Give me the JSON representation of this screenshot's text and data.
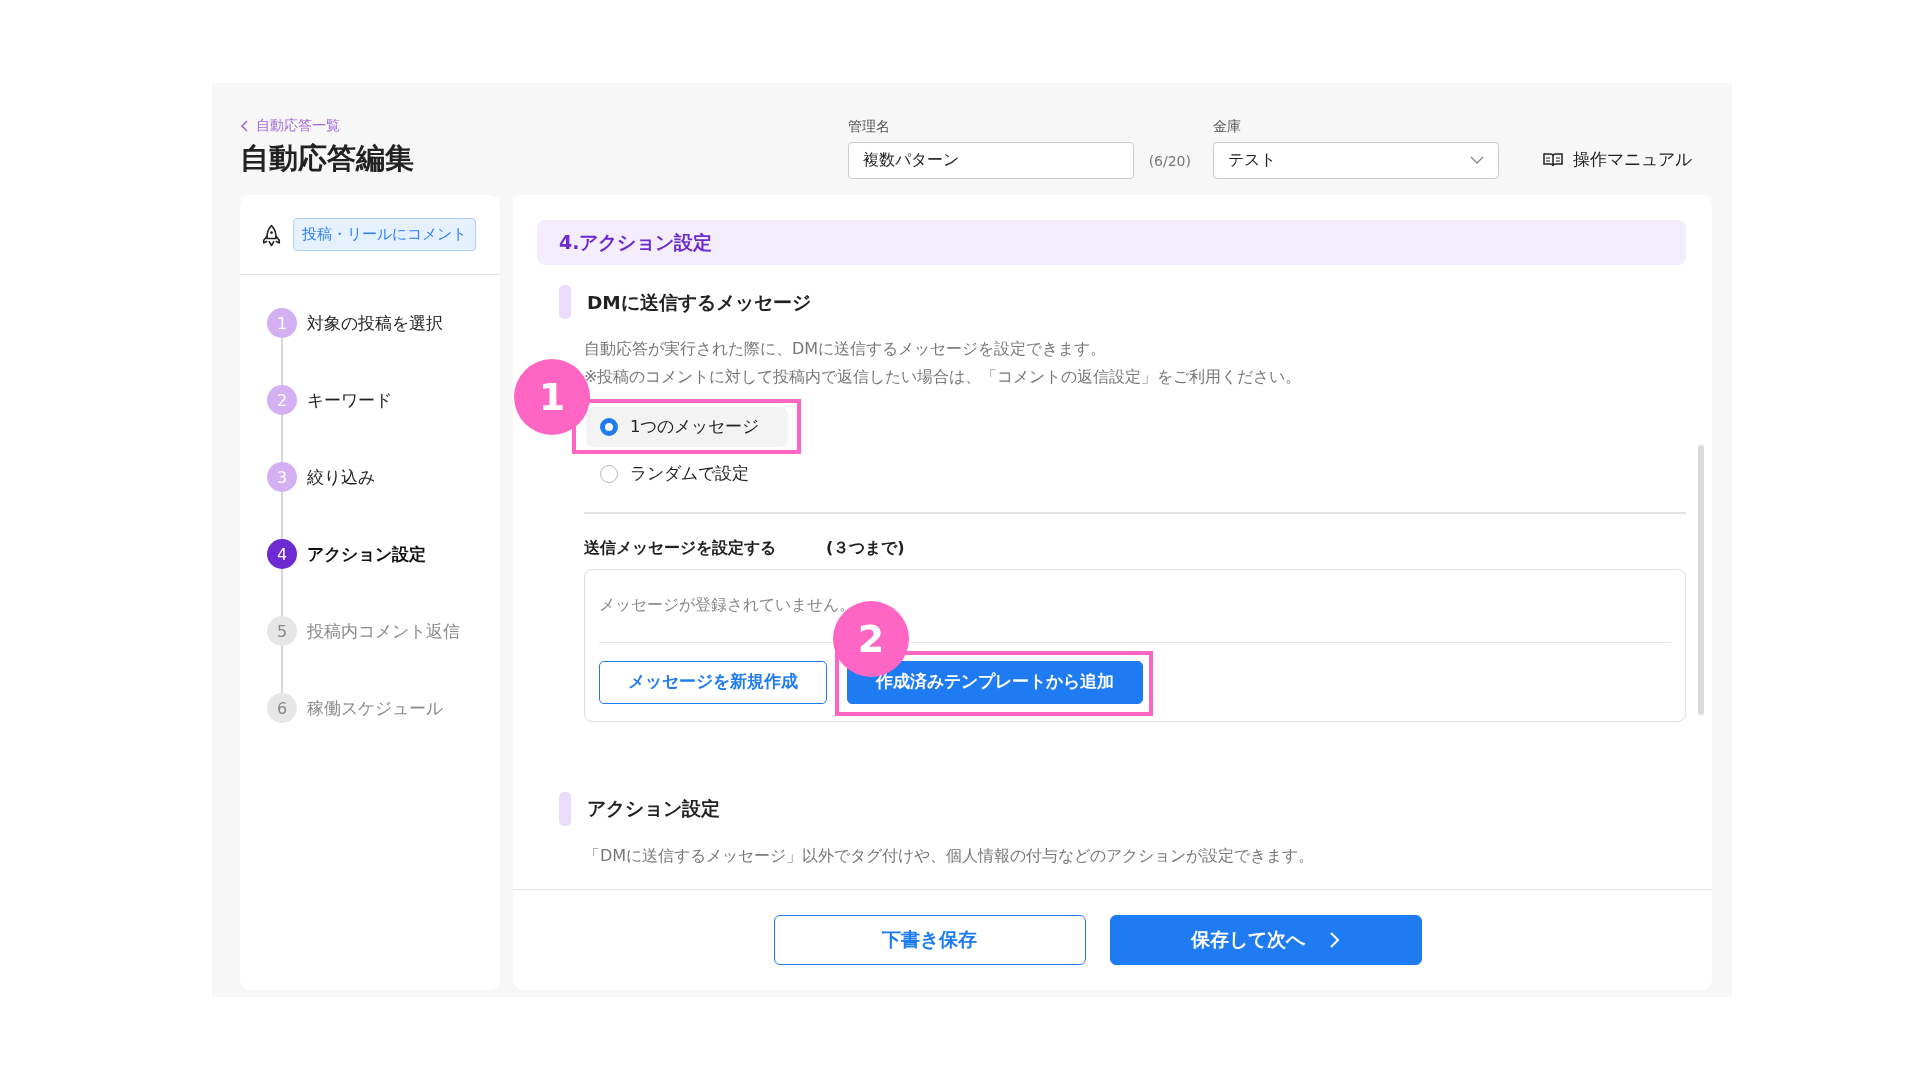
{
  "breadcrumb": {
    "label": "自動応答一覧"
  },
  "page_title": "自動応答編集",
  "name_field": {
    "label": "管理名",
    "value": "複数パターン",
    "counter": "(6/20)"
  },
  "vault_select": {
    "label": "金庫",
    "value": "テスト"
  },
  "manual_link": {
    "label": "操作マニュアル"
  },
  "sidebar": {
    "trigger_tag": "投稿・リールにコメント",
    "steps": [
      {
        "number": "1",
        "label": "対象の投稿を選択",
        "completed": true,
        "selected": false
      },
      {
        "number": "2",
        "label": "キーワード",
        "completed": true,
        "selected": false
      },
      {
        "number": "3",
        "label": "絞り込み",
        "completed": true,
        "selected": false
      },
      {
        "number": "4",
        "label": "アクション設定",
        "completed": false,
        "selected": true
      },
      {
        "number": "5",
        "label": "投稿内コメント返信",
        "completed": false,
        "selected": false
      },
      {
        "number": "6",
        "label": "稼働スケジュール",
        "completed": false,
        "selected": false
      }
    ]
  },
  "section_banner": "4.アクション設定",
  "dm_section": {
    "heading": "DMに送信するメッセージ",
    "description": [
      "自動応答が実行された際に、DMに送信するメッセージを設定できます。",
      "※投稿のコメントに対して投稿内で返信したい場合は、「コメントの返信設定」をご利用ください。"
    ],
    "options": [
      {
        "label": "1つのメッセージ",
        "selected": true,
        "callout": "1"
      },
      {
        "label": "ランダムで設定",
        "selected": false
      }
    ],
    "messages": {
      "heading": "送信メッセージを設定する",
      "limit": "(３つまで)",
      "empty_text": "メッセージが登録されていません。",
      "buttons": [
        {
          "label": "メッセージを新規作成",
          "kind": "outline"
        },
        {
          "label": "作成済みテンプレートから追加",
          "kind": "primary",
          "callout": "2"
        }
      ]
    }
  },
  "action_section": {
    "heading": "アクション設定",
    "description": "「DMに送信するメッセージ」以外でタグ付けや、個人情報の付与などのアクションが設定できます。"
  },
  "footer_buttons": [
    {
      "label": "下書き保存",
      "kind": "outline"
    },
    {
      "label": "保存して次へ",
      "kind": "primary",
      "chevron": true
    }
  ]
}
